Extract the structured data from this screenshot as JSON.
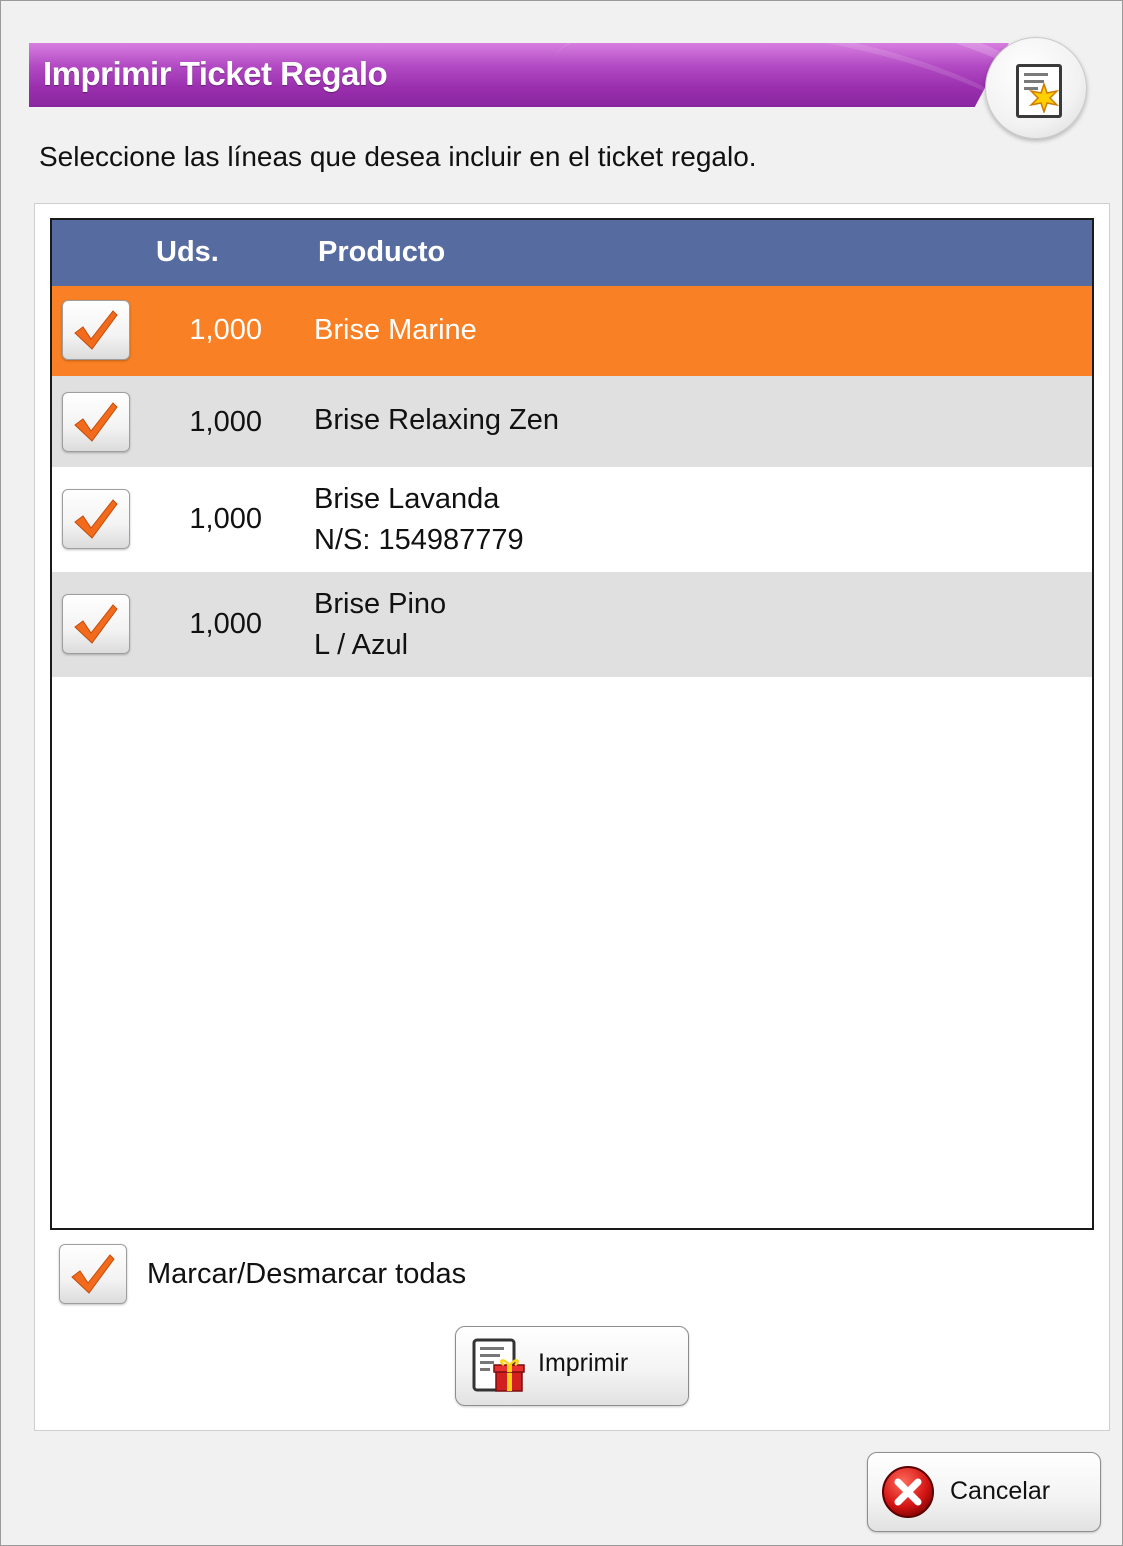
{
  "dialog": {
    "title": "Imprimir Ticket Regalo",
    "instruction": "Seleccione las líneas que desea incluir en el ticket regalo.",
    "title_icon": "ticket-star-icon",
    "accent_color": "#b34bc4"
  },
  "table": {
    "headers": {
      "quantity": "Uds.",
      "product": "Producto"
    },
    "header_color": "#566b9f",
    "selected_row_color": "#f98024",
    "rows": [
      {
        "checked": true,
        "quantity": "1,000",
        "product": "Brise Marine",
        "detail": "",
        "selected": true
      },
      {
        "checked": true,
        "quantity": "1,000",
        "product": "Brise Relaxing Zen",
        "detail": "",
        "selected": false
      },
      {
        "checked": true,
        "quantity": "1,000",
        "product": "Brise Lavanda",
        "detail": "N/S: 154987779",
        "selected": false
      },
      {
        "checked": true,
        "quantity": "1,000",
        "product": "Brise Pino",
        "detail": "L / Azul",
        "selected": false
      }
    ]
  },
  "toggle_all": {
    "label": "Marcar/Desmarcar todas",
    "checked": true
  },
  "buttons": {
    "print": {
      "label": "Imprimir",
      "icon": "gift-ticket-icon"
    },
    "cancel": {
      "label": "Cancelar",
      "icon": "cancel-x-icon"
    }
  }
}
